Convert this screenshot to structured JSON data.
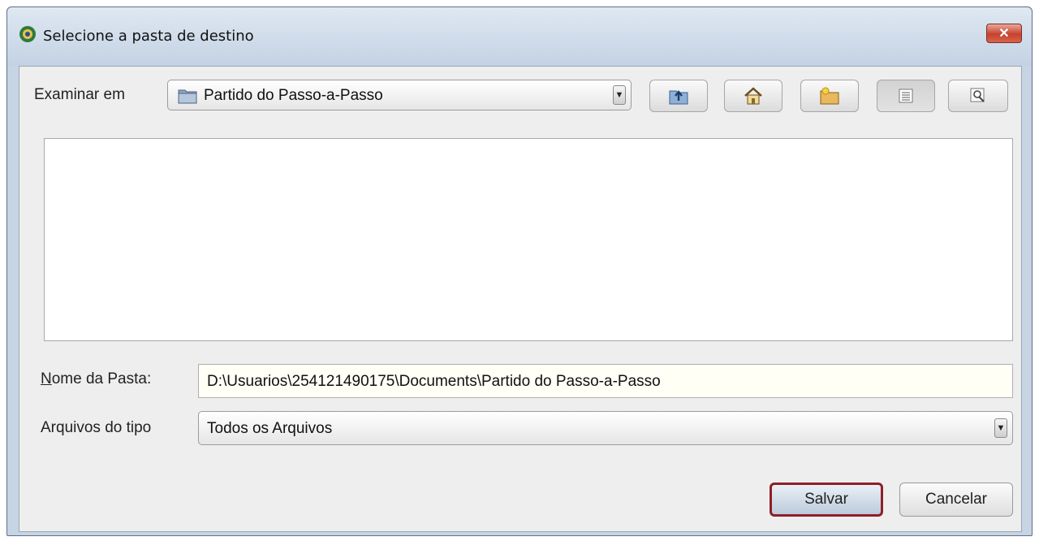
{
  "window": {
    "title": "Selecione a pasta de destino",
    "close_label": "✕"
  },
  "look_in": {
    "label": "Examinar em",
    "value": "Partido do Passo-a-Passo"
  },
  "toolbar": {
    "icons": [
      "up-folder-icon",
      "home-icon",
      "new-folder-icon",
      "list-view-icon",
      "details-view-icon"
    ]
  },
  "folder_name": {
    "label_first": "N",
    "label_rest": "ome da Pasta:",
    "value": "D:\\Usuarios\\254121490175\\Documents\\Partido do Passo-a-Passo"
  },
  "file_type": {
    "label": "Arquivos do tipo",
    "value": "Todos os Arquivos"
  },
  "buttons": {
    "save": "Salvar",
    "cancel": "Cancelar"
  },
  "colors": {
    "title_bg": "#c7d4e3",
    "close_red": "#c6422f",
    "save_border": "#8e1f28"
  }
}
